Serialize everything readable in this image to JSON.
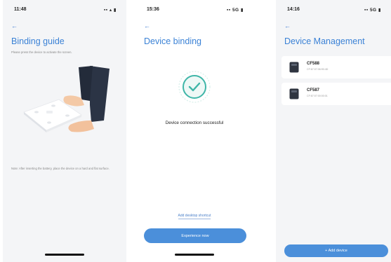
{
  "screens": [
    {
      "status_time": "11:48",
      "status_icons": "▪▪ ▴ ▮",
      "back_label": "←",
      "title": "Binding guide",
      "subtitle": "Please press the device to activate the screen.",
      "note": "Note: After inserting the battery, place the device on a hard and flat surface."
    },
    {
      "status_time": "15:36",
      "status_icons": "▪▪ 5G ▮",
      "back_label": "←",
      "title": "Device binding",
      "success_text": "Device connection successful",
      "link_label": "Add desktop shortcut",
      "button_label": "Experience now"
    },
    {
      "status_time": "14:16",
      "status_icons": "▪▪ 5G ▮",
      "back_label": "←",
      "title": "Device Management",
      "devices": [
        {
          "name": "CF588",
          "mac": "CF:67:07:06:90:4D"
        },
        {
          "name": "CF587",
          "mac": "CF:67:07:00:00:01"
        }
      ],
      "button_label": "+ Add device"
    }
  ],
  "colors": {
    "accent": "#3b82d6",
    "button": "#4b8fda",
    "success": "#3fb6a8",
    "background": "#f4f5f7"
  }
}
